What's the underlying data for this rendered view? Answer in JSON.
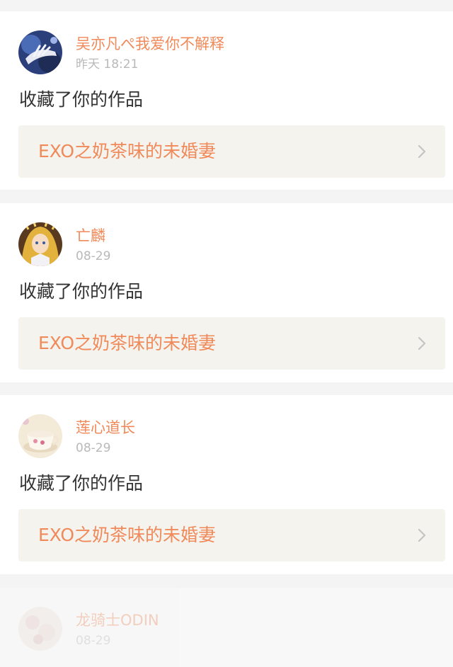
{
  "feed": {
    "items": [
      {
        "username": "吴亦凡ぺ我爱你不解释",
        "time": "昨天 18:21",
        "action": "收藏了你的作品",
        "work_title": "EXO之奶茶味的未婚妻",
        "avatar_icon": "avatar-hand-photo"
      },
      {
        "username": "亡麟",
        "time": "08-29",
        "action": "收藏了你的作品",
        "work_title": "EXO之奶茶味的未婚妻",
        "avatar_icon": "avatar-anime-girl"
      },
      {
        "username": "莲心道长",
        "time": "08-29",
        "action": "收藏了你的作品",
        "work_title": "EXO之奶茶味的未婚妻",
        "avatar_icon": "avatar-teacup"
      },
      {
        "username": "龙骑士ODIN",
        "time": "08-29",
        "avatar_icon": "avatar-floral"
      }
    ]
  },
  "colors": {
    "accent": "#f08a5a",
    "muted_text": "#b9b9b9",
    "body_text": "#333333",
    "link_bg": "#f4f3ee",
    "page_bg": "#f4f4f4"
  }
}
